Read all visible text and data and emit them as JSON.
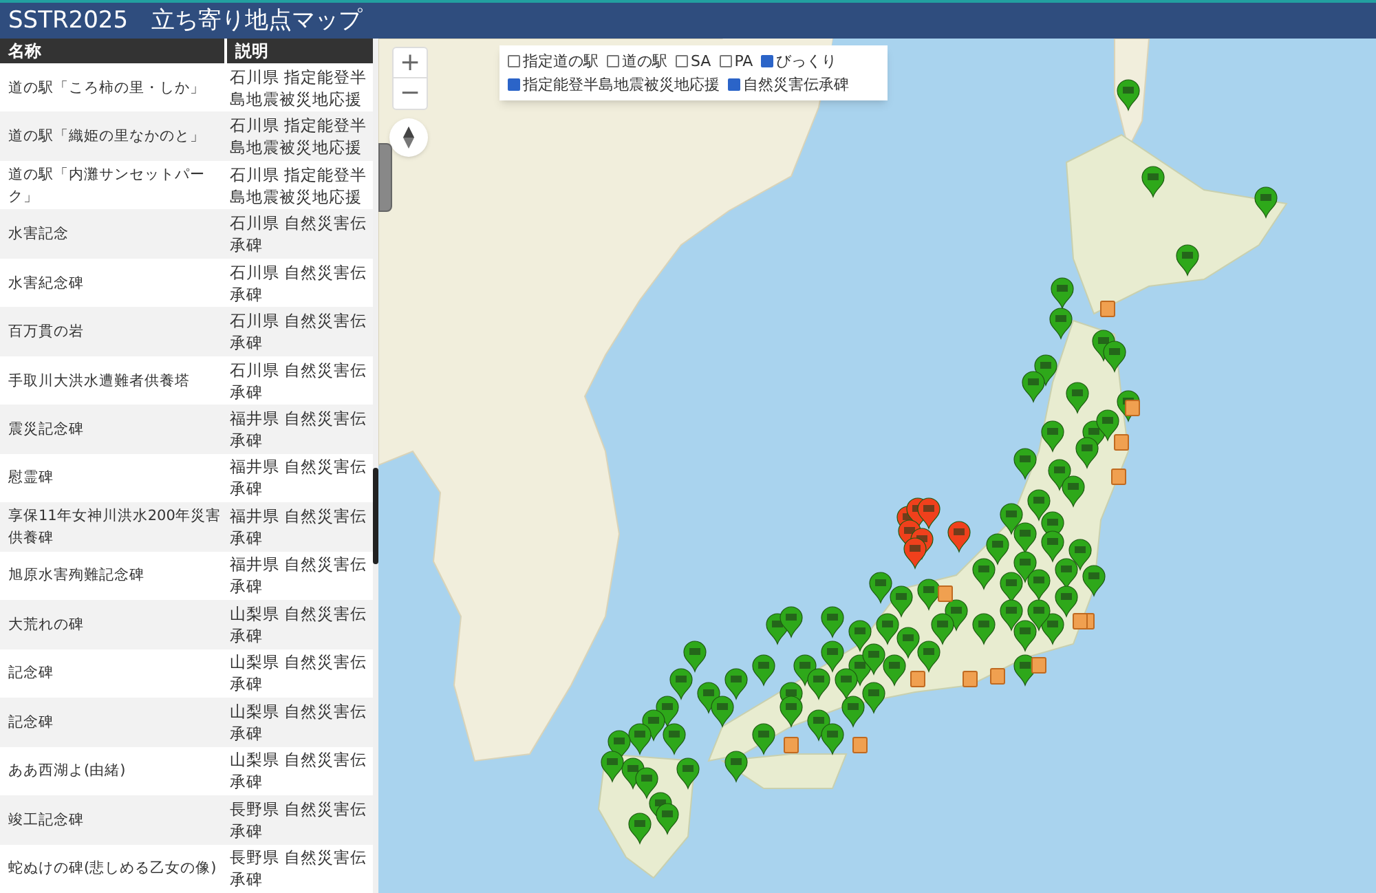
{
  "header": {
    "title": "SSTR2025　立ち寄り地点マップ"
  },
  "table": {
    "columns": [
      "名称",
      "説明"
    ],
    "rows": [
      {
        "name": "道の駅「ころ柿の里・しか」",
        "description": "石川県 指定能登半島地震被災地応援"
      },
      {
        "name": "道の駅「織姫の里なかのと」",
        "description": "石川県 指定能登半島地震被災地応援"
      },
      {
        "name": "道の駅「内灘サンセットパーク」",
        "description": "石川県 指定能登半島地震被災地応援"
      },
      {
        "name": "水害記念",
        "description": "石川県 自然災害伝承碑"
      },
      {
        "name": "水害紀念碑",
        "description": "石川県 自然災害伝承碑"
      },
      {
        "name": "百万貫の岩",
        "description": "石川県 自然災害伝承碑"
      },
      {
        "name": "手取川大洪水遭難者供養塔",
        "description": "石川県 自然災害伝承碑"
      },
      {
        "name": "震災記念碑",
        "description": "福井県 自然災害伝承碑"
      },
      {
        "name": "慰霊碑",
        "description": "福井県 自然災害伝承碑"
      },
      {
        "name": "享保11年女神川洪水200年災害供養碑",
        "description": "福井県 自然災害伝承碑"
      },
      {
        "name": "旭原水害殉難記念碑",
        "description": "福井県 自然災害伝承碑"
      },
      {
        "name": "大荒れの碑",
        "description": "山梨県 自然災害伝承碑"
      },
      {
        "name": "記念碑",
        "description": "山梨県 自然災害伝承碑"
      },
      {
        "name": "記念碑",
        "description": "山梨県 自然災害伝承碑"
      },
      {
        "name": "ああ西湖よ(由緒)",
        "description": "山梨県 自然災害伝承碑"
      },
      {
        "name": "竣工記念碑",
        "description": "長野県 自然災害伝承碑"
      },
      {
        "name": "蛇ぬけの碑(悲しめる乙女の像)",
        "description": "長野県 自然災害伝承碑"
      }
    ]
  },
  "map": {
    "zoom_in": "+",
    "zoom_out": "−",
    "layers": [
      {
        "label": "指定道の駅",
        "checked": false
      },
      {
        "label": "道の駅",
        "checked": false
      },
      {
        "label": "SA",
        "checked": false
      },
      {
        "label": "PA",
        "checked": false
      },
      {
        "label": "びっくり",
        "checked": true
      },
      {
        "label": "指定能登半島地震被災地応援",
        "checked": true
      },
      {
        "label": "自然災害伝承碑",
        "checked": true
      }
    ]
  }
}
